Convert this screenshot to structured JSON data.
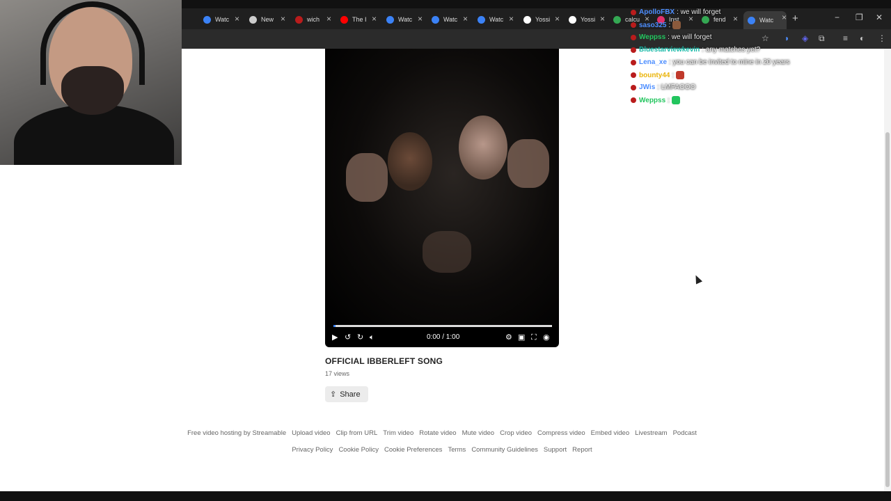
{
  "browser": {
    "tabs": [
      {
        "label": "Watc",
        "icon": "streamable-icon",
        "color": "#3b82f6"
      },
      {
        "label": "New",
        "icon": "chrome-icon",
        "color": "#cccccc"
      },
      {
        "label": "wich",
        "icon": "site-icon",
        "color": "#b91c1c"
      },
      {
        "label": "The I",
        "icon": "youtube-icon",
        "color": "#ff0000"
      },
      {
        "label": "Watc",
        "icon": "streamable-icon",
        "color": "#3b82f6"
      },
      {
        "label": "Watc",
        "icon": "streamable-icon",
        "color": "#3b82f6"
      },
      {
        "label": "Watc",
        "icon": "streamable-icon",
        "color": "#3b82f6"
      },
      {
        "label": "Yossi",
        "icon": "x-icon",
        "color": "#ffffff"
      },
      {
        "label": "Yossi",
        "icon": "x-icon",
        "color": "#ffffff"
      },
      {
        "label": "calcu",
        "icon": "google-icon",
        "color": "#34a853"
      },
      {
        "label": "Inst",
        "icon": "instagram-icon",
        "color": "#e1306c"
      },
      {
        "label": "fend",
        "icon": "google-icon",
        "color": "#34a853"
      },
      {
        "label": "Watc",
        "icon": "streamable-icon",
        "color": "#3b82f6"
      }
    ],
    "new_tab": "+",
    "window_controls": {
      "minimize": "−",
      "maximize": "❐",
      "close": "✕"
    }
  },
  "chat": {
    "lines": [
      {
        "user": "ApolloFBX",
        "user_color": "#4d8eff",
        "message": ": we will forget"
      },
      {
        "user": "saso325",
        "user_color": "#4d8eff",
        "message": ":",
        "emote_color": "#8b5a3c"
      },
      {
        "user": "Weppss",
        "user_color": "#22c55e",
        "message": ": we will forget"
      },
      {
        "user": "Bluestarviewkevin",
        "user_color": "#14b8a6",
        "message": ": any matches yet?"
      },
      {
        "user": "Lena_xe",
        "user_color": "#4d8eff",
        "message": ": you can be invited to mine in 20 years"
      },
      {
        "user": "bounty44",
        "user_color": "#eab308",
        "message": ":",
        "emote_color": "#c0392b"
      },
      {
        "user": "JWis",
        "user_color": "#4d8eff",
        "message": ": LMFAOOO"
      },
      {
        "user": "Weppss",
        "user_color": "#22c55e",
        "message": ":",
        "emote_color": "#22c55e"
      }
    ]
  },
  "player": {
    "time": "0:00 / 1:00",
    "progress": 0.01,
    "accent": "#3b82f6"
  },
  "video": {
    "title": "OFFICIAL IBBERLEFT SONG",
    "views": "17 views",
    "share_label": "Share"
  },
  "footer": {
    "row1": [
      "Free video hosting by Streamable",
      "Upload video",
      "Clip from URL",
      "Trim video",
      "Rotate video",
      "Mute video",
      "Crop video",
      "Compress video",
      "Embed video",
      "Livestream",
      "Podcast"
    ],
    "row2": [
      "Privacy Policy",
      "Cookie Policy",
      "Cookie Preferences",
      "Terms",
      "Community Guidelines",
      "Support",
      "Report"
    ]
  }
}
